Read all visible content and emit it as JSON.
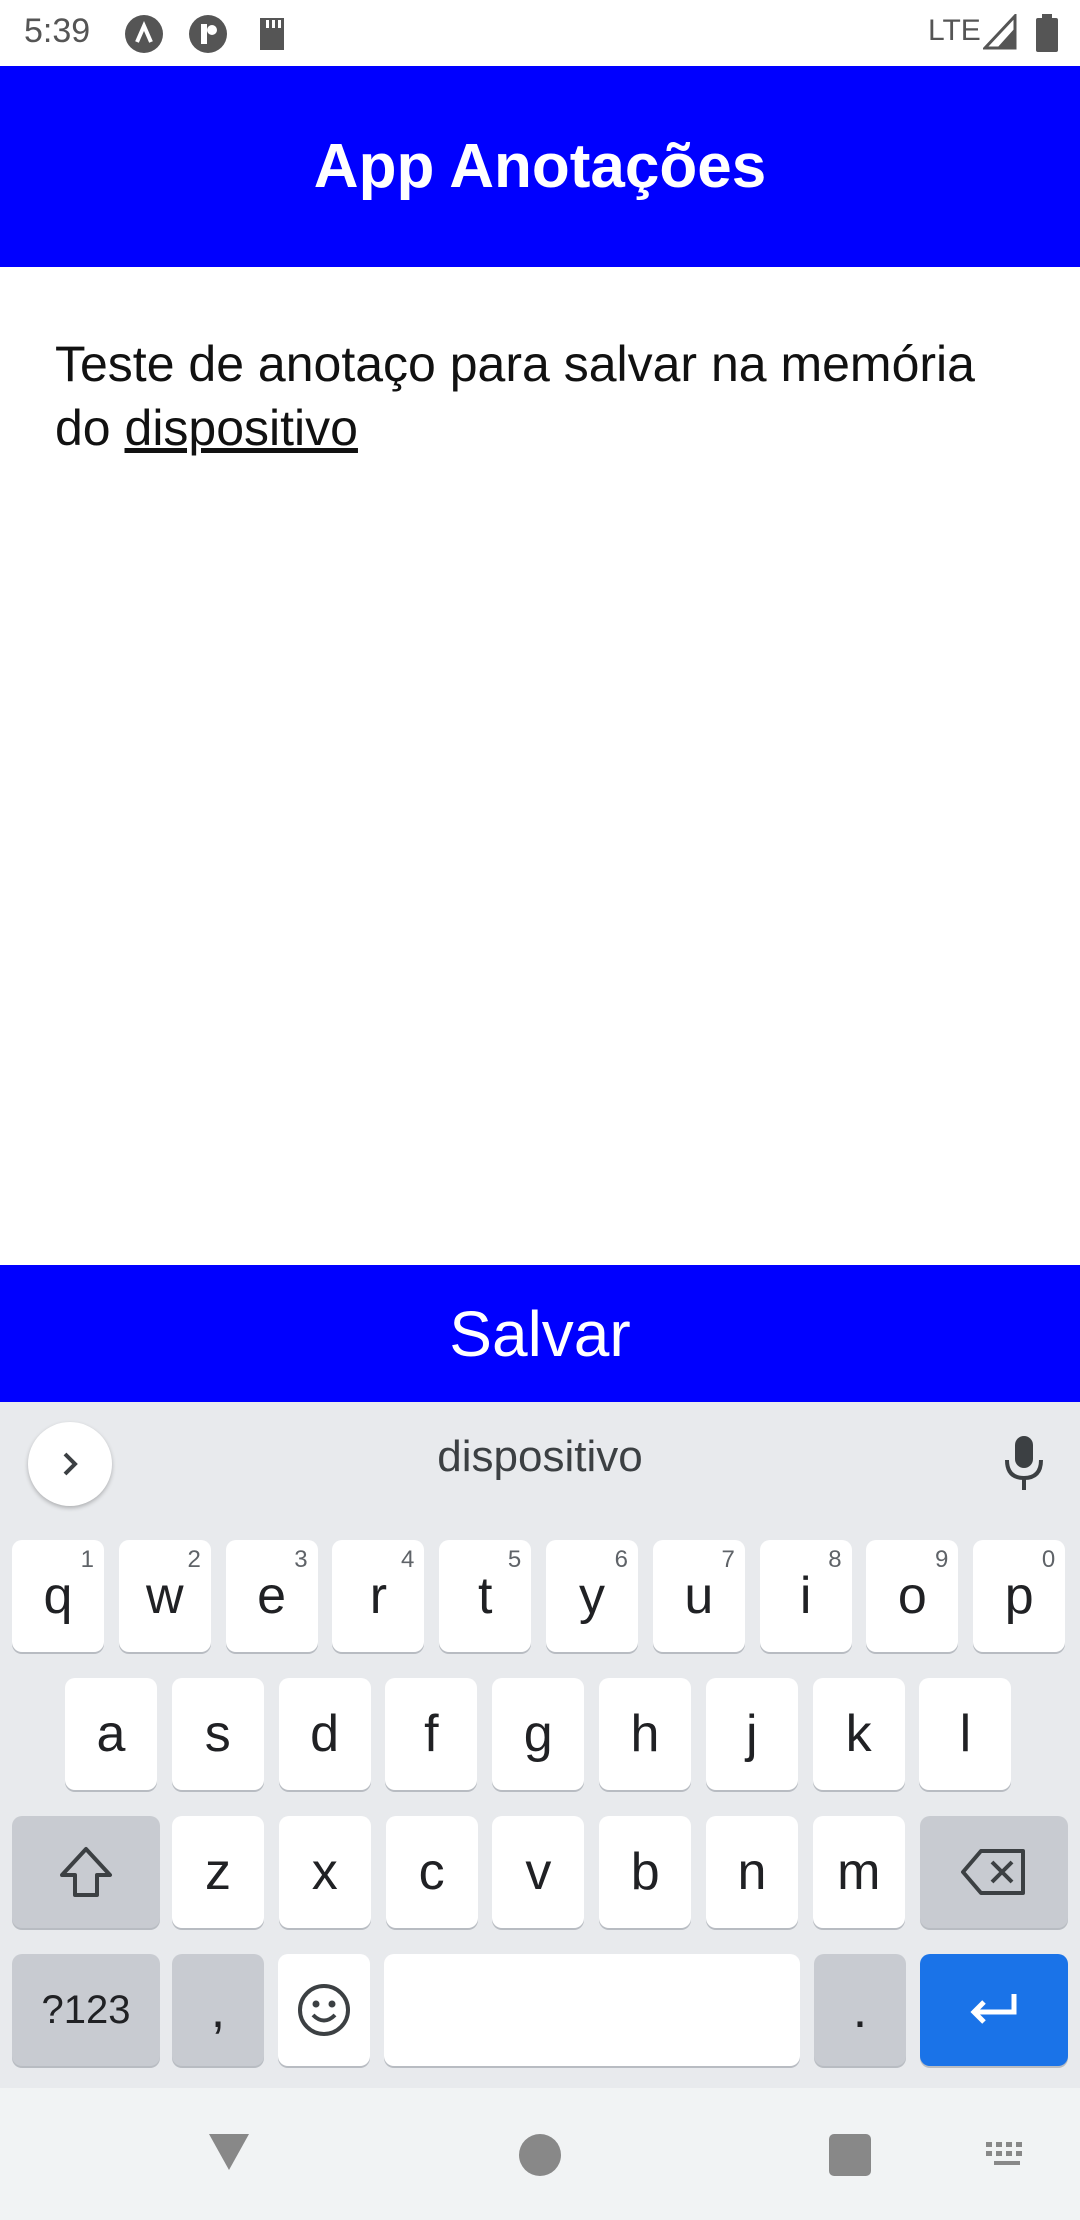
{
  "status_bar": {
    "time": "5:39",
    "network": "LTE",
    "icons": [
      "at-sign-icon",
      "app-icon",
      "sd-card-icon",
      "signal-icon",
      "battery-icon"
    ]
  },
  "app_bar": {
    "title": "App Anotações",
    "color": "#0000ff"
  },
  "note": {
    "text_before": "Teste de anotaço para salvar na memória do ",
    "text_underlined": "dispositivo"
  },
  "save_button": {
    "label": "Salvar",
    "color": "#0000ff"
  },
  "keyboard": {
    "suggestion": "dispositivo",
    "row1": [
      {
        "k": "q",
        "h": "1"
      },
      {
        "k": "w",
        "h": "2"
      },
      {
        "k": "e",
        "h": "3"
      },
      {
        "k": "r",
        "h": "4"
      },
      {
        "k": "t",
        "h": "5"
      },
      {
        "k": "y",
        "h": "6"
      },
      {
        "k": "u",
        "h": "7"
      },
      {
        "k": "i",
        "h": "8"
      },
      {
        "k": "o",
        "h": "9"
      },
      {
        "k": "p",
        "h": "0"
      }
    ],
    "row2": [
      "a",
      "s",
      "d",
      "f",
      "g",
      "h",
      "j",
      "k",
      "l"
    ],
    "row3": [
      "z",
      "x",
      "c",
      "v",
      "b",
      "n",
      "m"
    ],
    "symbols_label": "?123",
    "comma_label": ",",
    "period_label": ".",
    "enter_color": "#1a73e8"
  },
  "nav_bar": {
    "icons": [
      "back-icon",
      "home-icon",
      "recent-apps-icon",
      "keyboard-switch-icon"
    ]
  }
}
